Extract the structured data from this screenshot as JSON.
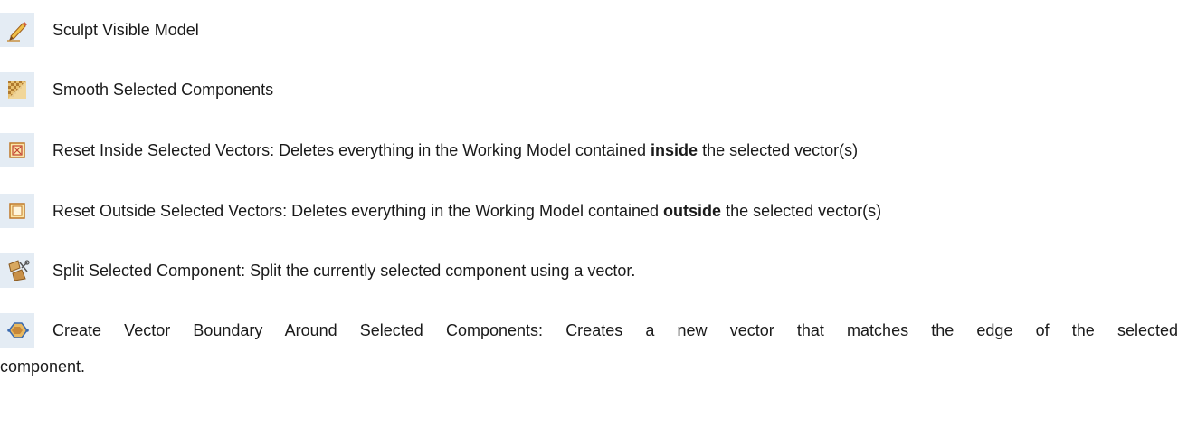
{
  "items": [
    {
      "icon": "sculpt-pencil-icon",
      "text": "Sculpt Visible Model"
    },
    {
      "icon": "smooth-texture-icon",
      "text": "Smooth Selected Components"
    },
    {
      "icon": "reset-inside-icon",
      "text_before": "Reset Inside Selected Vectors: Deletes everything in the Working Model contained ",
      "bold": "inside",
      "text_after": " the selected vector(s)"
    },
    {
      "icon": "reset-outside-icon",
      "text_before": "Reset Outside Selected Vectors: Deletes everything in the Working Model contained ",
      "bold": "outside",
      "text_after": " the selected vector(s)"
    },
    {
      "icon": "split-component-icon",
      "text": "Split Selected Component: Split the currently selected component using a vector."
    },
    {
      "icon": "vector-boundary-icon",
      "text_line1": "Create Vector Boundary Around Selected Components: Creates a new vector that matches the edge of the selected",
      "text_line2": "component."
    }
  ]
}
